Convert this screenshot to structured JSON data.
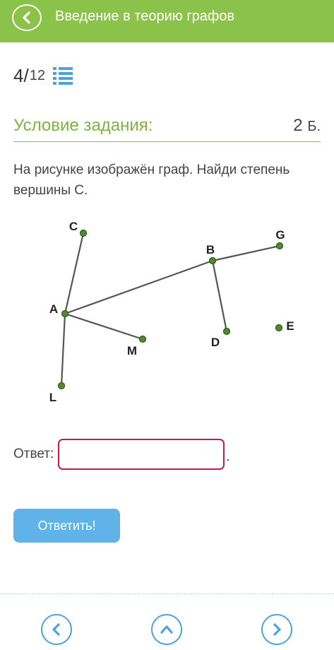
{
  "header": {
    "title": "Введение в теорию графов",
    "back_icon": "chevron-left-icon"
  },
  "progress": {
    "current": "4",
    "separator": "/",
    "total": "12",
    "list_icon": "list-icon"
  },
  "task": {
    "heading": "Условие задания:",
    "points_value": "2",
    "points_unit": "Б.",
    "text": "На рисунке изображён граф. Найди степень вершины C."
  },
  "graph": {
    "vertices": [
      {
        "label": "C"
      },
      {
        "label": "A"
      },
      {
        "label": "L"
      },
      {
        "label": "M"
      },
      {
        "label": "B"
      },
      {
        "label": "G"
      },
      {
        "label": "D"
      },
      {
        "label": "E"
      }
    ],
    "edges": [
      [
        "A",
        "C"
      ],
      [
        "A",
        "L"
      ],
      [
        "A",
        "M"
      ],
      [
        "A",
        "B"
      ],
      [
        "B",
        "G"
      ],
      [
        "B",
        "D"
      ]
    ]
  },
  "answer": {
    "label": "Ответ:",
    "value": "",
    "placeholder": "",
    "suffix": "."
  },
  "submit": {
    "label": "Ответить!"
  },
  "nav": {
    "prev_icon": "chevron-left-icon",
    "up_icon": "chevron-up-icon",
    "next_icon": "chevron-right-icon"
  },
  "colors": {
    "header": "#8bc34a",
    "accent_text": "#7cb342",
    "button": "#5fb3e8",
    "input_border": "#c2185b",
    "vertex": "#4e8a2e"
  }
}
